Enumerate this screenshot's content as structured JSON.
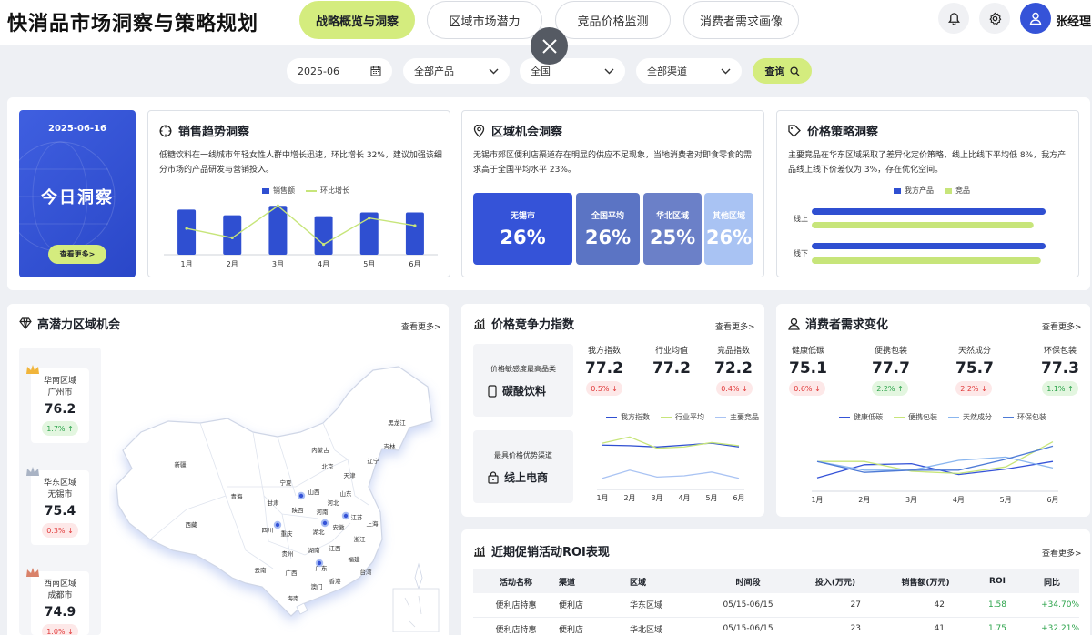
{
  "header": {
    "title": "快消品市场洞察与策略规划",
    "tabs": [
      "战略概览与洞察",
      "区域市场潜力",
      "竞品价格监测",
      "消费者需求画像"
    ],
    "active_tab": 0,
    "user_name": "张经理"
  },
  "filters": {
    "date": "2025-06",
    "product": "全部产品",
    "region": "全国",
    "channel": "全部渠道",
    "query_label": "查询"
  },
  "today": {
    "date": "2025-06-16",
    "title": "今日洞察",
    "more": "查看更多>"
  },
  "sales_trend": {
    "title": "销售趋势洞察",
    "desc": "低糖饮料在一线城市年轻女性人群中增长迅速，环比增长 32%，建议加强该细分市场的产品研发与营销投入。",
    "legend_bar": "销售额",
    "legend_line": "环比增长",
    "chart_data": {
      "type": "bar",
      "categories": [
        "1月",
        "2月",
        "3月",
        "4月",
        "5月",
        "6月"
      ],
      "series": [
        {
          "name": "销售额",
          "values": [
            48,
            42,
            52,
            41,
            45,
            45
          ]
        },
        {
          "name": "环比增长",
          "values": [
            28,
            18,
            52,
            11,
            39,
            31
          ]
        }
      ],
      "ylim": [
        0,
        60
      ],
      "colors": [
        "#2f4fd1",
        "#c7e57a"
      ]
    }
  },
  "region_opportunity": {
    "title": "区域机会洞察",
    "desc": "无锡市郊区便利店渠道存在明显的供应不足现象，当地消费者对即食零食的需求高于全国平均水平 23%。",
    "stats": [
      {
        "name": "无锡市",
        "value": "26%",
        "color": "#3553d8"
      },
      {
        "name": "全国平均",
        "value": "26%",
        "color": "#5b74c4"
      },
      {
        "name": "华北区域",
        "value": "25%",
        "color": "#6b80c8"
      },
      {
        "name": "其他区域",
        "value": "26%",
        "color": "#a9c3f3"
      }
    ]
  },
  "price_strategy": {
    "title": "价格策略洞察",
    "desc": "主要竞品在华东区域采取了差异化定价策略，线上比线下平均低 8%，我方产品线上线下价差仅为 3%，存在优化空间。",
    "legend": [
      "我方产品",
      "竞品"
    ],
    "chart_data": {
      "type": "bar",
      "categories": [
        "线上",
        "线下"
      ],
      "series": [
        {
          "name": "我方产品",
          "values": [
            97,
            97
          ]
        },
        {
          "name": "竞品",
          "values": [
            92,
            95
          ]
        }
      ],
      "colors": [
        "#2f4fd1",
        "#c7e57a"
      ]
    }
  },
  "high_potential": {
    "title": "高潜力区域机会",
    "more": "查看更多>",
    "items": [
      {
        "region": "华南区域",
        "city": "广州市",
        "score": "76.2",
        "change": "1.7% ↑",
        "dir": "up",
        "crown": "#f1b53b"
      },
      {
        "region": "华东区域",
        "city": "无锡市",
        "score": "75.4",
        "change": "0.3% ↓",
        "dir": "down",
        "crown": "#a9b3c4"
      },
      {
        "region": "西南区域",
        "city": "成都市",
        "score": "74.9",
        "change": "1.0% ↓",
        "dir": "down",
        "crown": "#d9826a"
      }
    ],
    "map_labels": [
      "黑龙江",
      "吉林",
      "内蒙古",
      "辽宁",
      "北京",
      "天津",
      "新疆",
      "山西",
      "山东",
      "宁夏",
      "河北",
      "青海",
      "甘肃",
      "陕西",
      "河南",
      "江苏",
      "上海",
      "西藏",
      "四川",
      "重庆",
      "湖北",
      "安徽",
      "浙江",
      "江西",
      "贵州",
      "湖南",
      "福建",
      "云南",
      "广西",
      "广东",
      "台湾",
      "香港",
      "澳门",
      "海南"
    ]
  },
  "price_index": {
    "title": "价格竞争力指数",
    "more": "查看更多>",
    "box1_label": "价格敏感度最高品类",
    "box1_value": "碳酸饮料",
    "box2_label": "最具价格优势渠道",
    "box2_value": "线上电商",
    "metrics": [
      {
        "label": "我方指数",
        "value": "77.2",
        "change": "0.5% ↓",
        "dir": "down"
      },
      {
        "label": "行业均值",
        "value": "77.2",
        "change": "",
        "dir": ""
      },
      {
        "label": "竞品指数",
        "value": "72.2",
        "change": "0.4% ↓",
        "dir": "down"
      }
    ],
    "chart_data": {
      "type": "line",
      "categories": [
        "1月",
        "2月",
        "3月",
        "4月",
        "5月",
        "6月"
      ],
      "series": [
        {
          "name": "我方指数",
          "values": [
            77.5,
            77.4,
            77.2,
            77.5,
            77.8,
            77.2
          ]
        },
        {
          "name": "行业平均",
          "values": [
            77.8,
            78.8,
            77.0,
            77.2,
            77.9,
            77.4
          ]
        },
        {
          "name": "主要竞品",
          "values": [
            72.2,
            73.5,
            72.4,
            72.6,
            73.2,
            72.2
          ]
        }
      ],
      "ylim": [
        71,
        80
      ],
      "colors": [
        "#2f4fd1",
        "#c7e57a",
        "#a9c3f3"
      ]
    }
  },
  "consumer": {
    "title": "消费者需求变化",
    "more": "查看更多>",
    "metrics": [
      {
        "label": "健康低碳",
        "value": "75.1",
        "change": "0.6% ↓",
        "dir": "down"
      },
      {
        "label": "便携包装",
        "value": "77.7",
        "change": "2.2% ↑",
        "dir": "up"
      },
      {
        "label": "天然成分",
        "value": "75.7",
        "change": "2.2% ↓",
        "dir": "down"
      },
      {
        "label": "环保包装",
        "value": "77.3",
        "change": "1.1% ↑",
        "dir": "up"
      }
    ],
    "chart_data": {
      "type": "line",
      "categories": [
        "1月",
        "2月",
        "3月",
        "4月",
        "5月",
        "6月"
      ],
      "series": [
        {
          "name": "健康低碳",
          "values": [
            74.4,
            75.6,
            75.7,
            74.7,
            75.2,
            75.9
          ]
        },
        {
          "name": "便携包装",
          "values": [
            75.9,
            75.9,
            75.0,
            74.8,
            75.4,
            77.7
          ]
        },
        {
          "name": "天然成分",
          "values": [
            75.9,
            75.1,
            75.1,
            76.0,
            76.3,
            75.3
          ]
        },
        {
          "name": "环保包装",
          "values": [
            75.9,
            74.9,
            75.1,
            75.1,
            76.1,
            77.3
          ]
        }
      ],
      "ylim": [
        73.5,
        78.5
      ],
      "colors": [
        "#3553d8",
        "#c7e57a",
        "#8ab6ef",
        "#4d7ad6"
      ]
    }
  },
  "roi": {
    "title": "近期促销活动ROI表现",
    "more": "查看更多>",
    "columns": [
      "活动名称",
      "渠道",
      "区域",
      "时间段",
      "投入(万元)",
      "销售额(万元)",
      "ROI",
      "同比"
    ],
    "rows": [
      [
        "便利店特惠",
        "便利店",
        "华东区域",
        "05/15-06/15",
        "27",
        "42",
        "1.58",
        "+34.70%"
      ],
      [
        "便利店特惠",
        "便利店",
        "华北区域",
        "05/15-06/15",
        "23",
        "41",
        "1.75",
        "+32.21%"
      ]
    ]
  }
}
